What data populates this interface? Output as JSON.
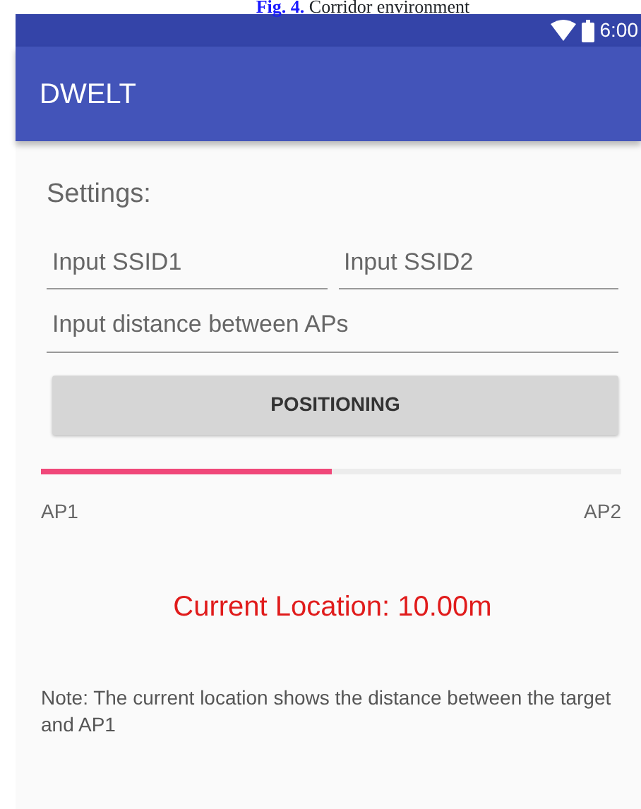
{
  "caption": {
    "label": "Fig. 4.",
    "text": "Corridor environment"
  },
  "status_bar": {
    "time": "6:00"
  },
  "app_bar": {
    "title": "DWELT"
  },
  "settings_label": "Settings:",
  "fields": [
    {
      "placeholder": "Input SSID1"
    },
    {
      "placeholder": "Input SSID2"
    },
    {
      "placeholder": "Input distance between APs"
    }
  ],
  "button": "POSITIONING",
  "progress": {
    "level": 0.5,
    "start_label": "AP1",
    "end_label": "AP2"
  },
  "current_location": "Current Location: 10.00m",
  "note": "Note: The current location shows the distance between the target and AP1"
}
